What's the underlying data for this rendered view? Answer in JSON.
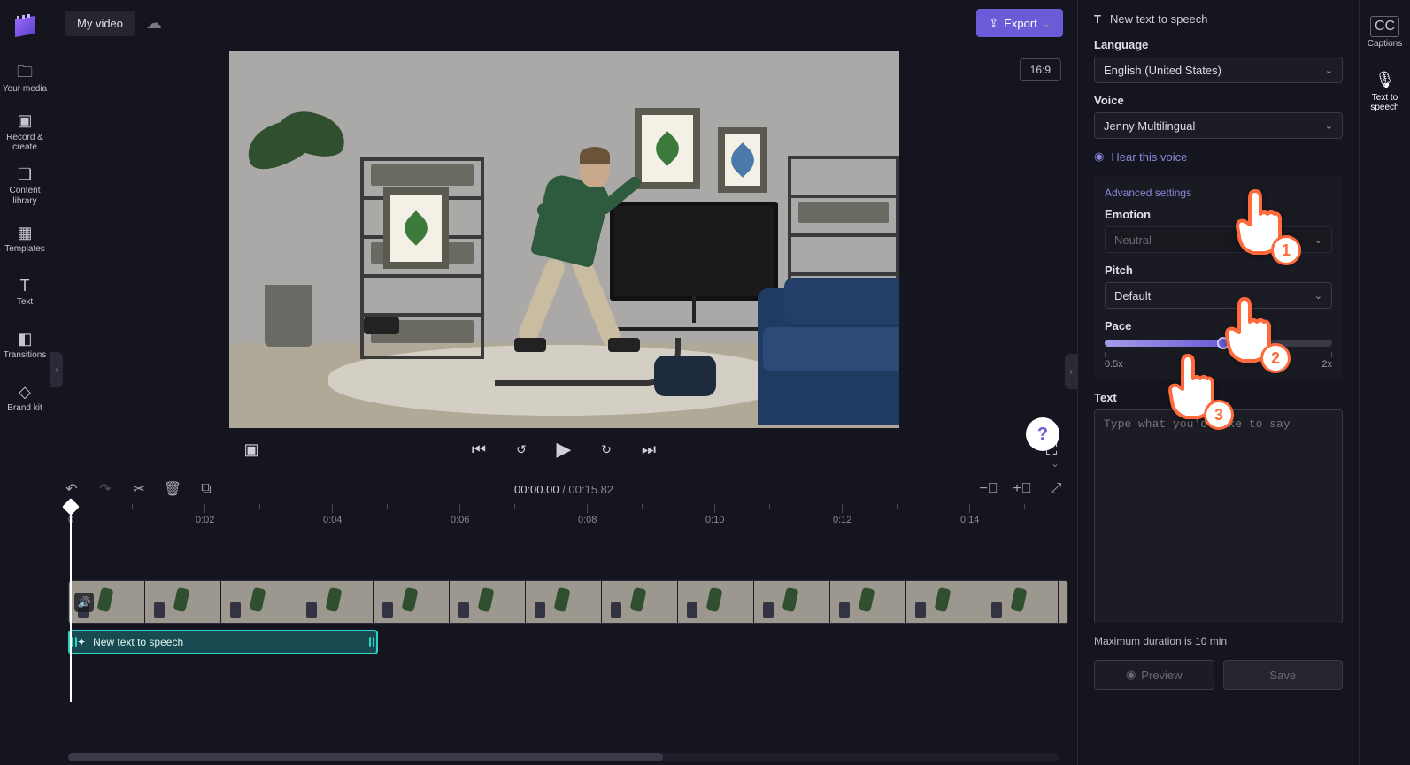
{
  "header": {
    "project_name": "My video",
    "export_label": "Export",
    "aspect_ratio": "16:9"
  },
  "left_rail": {
    "items": [
      {
        "label": "Your media"
      },
      {
        "label": "Record & create"
      },
      {
        "label": "Content library"
      },
      {
        "label": "Templates"
      },
      {
        "label": "Text"
      },
      {
        "label": "Transitions"
      },
      {
        "label": "Brand kit"
      }
    ]
  },
  "far_right": {
    "captions": "Captions",
    "tts": "Text to speech"
  },
  "transport": {
    "current_time": "00:00.00",
    "duration": "00:15.82"
  },
  "ruler": {
    "zero": "0",
    "marks": [
      "0:02",
      "0:04",
      "0:06",
      "0:08",
      "0:10",
      "0:12",
      "0:14"
    ]
  },
  "timeline": {
    "tts_clip_label": "New text to speech"
  },
  "tts_panel": {
    "title": "New text to speech",
    "language_label": "Language",
    "language_value": "English (United States)",
    "voice_label": "Voice",
    "voice_value": "Jenny Multilingual",
    "hear_voice": "Hear this voice",
    "advanced_title": "Advanced settings",
    "emotion_label": "Emotion",
    "emotion_value": "Neutral",
    "pitch_label": "Pitch",
    "pitch_value": "Default",
    "pace_label": "Pace",
    "pace_min": "0.5x",
    "pace_max": "2x",
    "text_label": "Text",
    "text_placeholder": "Type what you'd like to say",
    "hint": "Maximum duration is 10 min",
    "preview_btn": "Preview",
    "save_btn": "Save"
  },
  "annotations": {
    "n1": "1",
    "n2": "2",
    "n3": "3"
  }
}
